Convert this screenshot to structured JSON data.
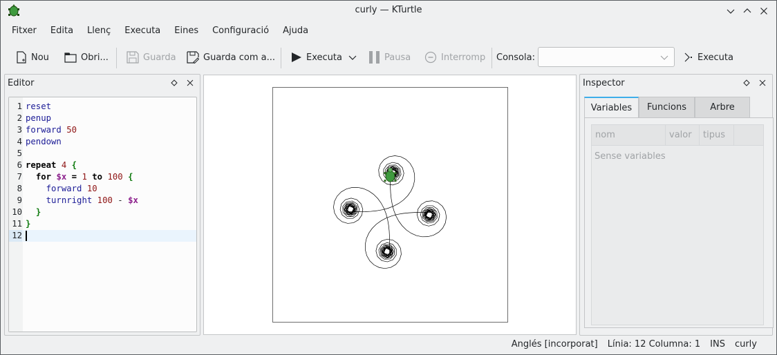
{
  "window": {
    "title": "curly — KTurtle",
    "icon": "kturtle-turtle-icon",
    "controls": [
      "minimize-icon",
      "maximize-icon",
      "close-icon"
    ]
  },
  "menubar": {
    "items": [
      "Fitxer",
      "Edita",
      "Llenç",
      "Executa",
      "Eines",
      "Configuració",
      "Ajuda"
    ]
  },
  "toolbar": {
    "new_label": "Nou",
    "open_label": "Obri...",
    "save_label": "Guarda",
    "save_as_label": "Guarda com a...",
    "run_label": "Executa",
    "pause_label": "Pausa",
    "stop_label": "Interromp",
    "console_label": "Consola:",
    "console_value": "",
    "console_run_label": "Executa"
  },
  "editor": {
    "title": "Editor",
    "lines": [
      {
        "n": "1"
      },
      {
        "n": "2"
      },
      {
        "n": "3"
      },
      {
        "n": "4"
      },
      {
        "n": "5"
      },
      {
        "n": "6"
      },
      {
        "n": "7"
      },
      {
        "n": "8"
      },
      {
        "n": "9"
      },
      {
        "n": "10"
      },
      {
        "n": "11"
      },
      {
        "n": "12"
      }
    ],
    "code": {
      "l1": "reset",
      "l2": "penup",
      "l3_cmd": "forward",
      "l3_num": "50",
      "l4": "pendown",
      "l6_kw": "repeat",
      "l6_num": "4",
      "l6_brace": "{",
      "l7_for": "for",
      "l7_var": "$x",
      "l7_eq": "=",
      "l7_from": "1",
      "l7_to": "to",
      "l7_toval": "100",
      "l7_brace": "{",
      "l8_cmd": "forward",
      "l8_num": "10",
      "l9_cmd": "turnright",
      "l9_num": "100",
      "l9_op": "-",
      "l9_var": "$x",
      "l10_brace": "}",
      "l11_brace": "}"
    },
    "current_line": 12
  },
  "canvas": {
    "program": {
      "reset": true,
      "penup_forward": 50,
      "repeat": 4,
      "for_from": 1,
      "for_to": 100,
      "step_forward": 10,
      "turn_base": 100
    },
    "pen_color": "#000000",
    "turtle_color": "#3e9a3e"
  },
  "inspector": {
    "title": "Inspector",
    "tabs": [
      "Variables",
      "Funcions",
      "Arbre"
    ],
    "active_tab": 0,
    "columns": [
      "nom",
      "valor",
      "tipus"
    ],
    "empty_text": "Sense variables"
  },
  "statusbar": {
    "language": "Anglés [incorporat]",
    "position": "Línia: 12 Columna: 1",
    "mode": "INS",
    "file": "curly"
  },
  "colors": {
    "accent": "#3daee9",
    "window_bg": "#eff0f1"
  }
}
